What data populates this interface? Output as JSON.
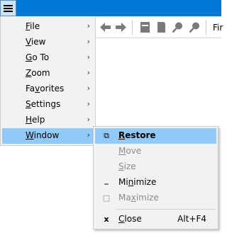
{
  "titlebar": {
    "accent": "#0078d7",
    "menu_icon": "hamburger-icon"
  },
  "toolbar": {
    "buttons": [
      "back-arrow-icon",
      "forward-arrow-icon",
      "page-icon",
      "document-icon",
      "zoom-in-icon",
      "zoom-out-icon"
    ],
    "search_label": "Fir"
  },
  "main_menu": {
    "items": [
      {
        "label": "File",
        "mnemonic": "F"
      },
      {
        "label": "View",
        "mnemonic": "V"
      },
      {
        "label": "Go To",
        "mnemonic": "G"
      },
      {
        "label": "Zoom",
        "mnemonic": "Z"
      },
      {
        "label": "Favorites",
        "mnemonic": "v"
      },
      {
        "label": "Settings",
        "mnemonic": "S"
      },
      {
        "label": "Help",
        "mnemonic": "H"
      },
      {
        "label": "Window",
        "mnemonic": "W",
        "selected": true
      }
    ],
    "submenu_arrow": "›"
  },
  "window_menu": {
    "items": [
      {
        "label": "Restore",
        "icon": "restore-icon",
        "glyph": "⧉",
        "enabled": true,
        "selected": true
      },
      {
        "label": "Move",
        "icon": "",
        "glyph": "",
        "enabled": false
      },
      {
        "label": "Size",
        "icon": "",
        "glyph": "",
        "enabled": false
      },
      {
        "label": "Minimize",
        "icon": "minimize-icon",
        "glyph": "_",
        "enabled": true
      },
      {
        "label": "Maximize",
        "icon": "maximize-icon",
        "glyph": "□",
        "enabled": false
      },
      {
        "label": "Close",
        "icon": "close-icon",
        "glyph": "x",
        "enabled": true,
        "shortcut": "Alt+F4"
      }
    ]
  },
  "colors": {
    "highlight": "#91c9f7",
    "menu_bg": "#f2f2f2",
    "disabled_text": "#8a8a8a"
  }
}
